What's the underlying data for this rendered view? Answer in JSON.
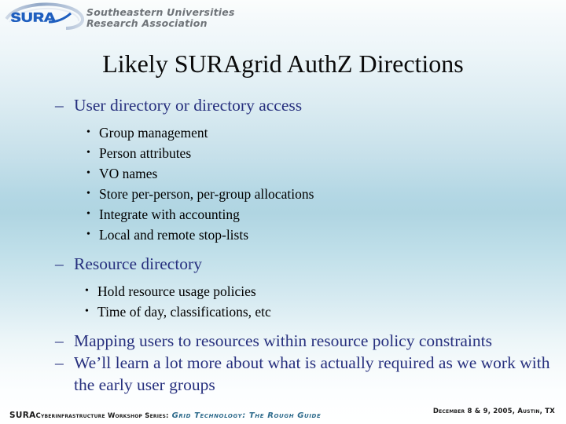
{
  "brand": {
    "logo_mark": "sura-swoosh-logo",
    "logo_wordmark": "SURA",
    "org_line1": "Southeastern Universities",
    "org_line2": "Research Association",
    "logo_color": "#1f5fbf",
    "org_text_color": "#6f7479"
  },
  "slide": {
    "title": "Likely SURAgrid AuthZ Directions",
    "title_color": "#0b0b0b",
    "level1_color": "#27307e",
    "level2_color": "#000000",
    "background_top": "#fbfdfd",
    "background_mid": "#b0d5e2",
    "background_bottom": "#ffffff",
    "dash_bullet": "–",
    "dot_bullet": "•"
  },
  "content": [
    {
      "level": 1,
      "text": "User directory or directory access",
      "children": [
        {
          "level": 2,
          "text": "Group management"
        },
        {
          "level": 2,
          "text": "Person attributes"
        },
        {
          "level": 2,
          "text": "VO names"
        },
        {
          "level": 2,
          "text": "Store per-person, per-group allocations"
        },
        {
          "level": 2,
          "text": "Integrate with accounting"
        },
        {
          "level": 2,
          "text": "Local and remote stop-lists"
        }
      ]
    },
    {
      "level": 1,
      "text": "Resource directory",
      "children": [
        {
          "level": 2,
          "text": "Hold resource usage policies"
        },
        {
          "level": 2,
          "text": "Time of day, classifications, etc"
        }
      ]
    },
    {
      "level": 1,
      "text": "Mapping users to resources within resource policy constraints",
      "children": []
    },
    {
      "level": 1,
      "text": "We’ll learn a lot more about what is actually required as we work with the early user groups",
      "children": []
    }
  ],
  "footer": {
    "sura": "SURA",
    "series": "Cyberinfrastructure Workshop Series:",
    "guide": "Grid Technology: The Rough Guide",
    "guide_color": "#2e6b8c",
    "date_location": "December 8 & 9, 2005, Austin, TX"
  }
}
